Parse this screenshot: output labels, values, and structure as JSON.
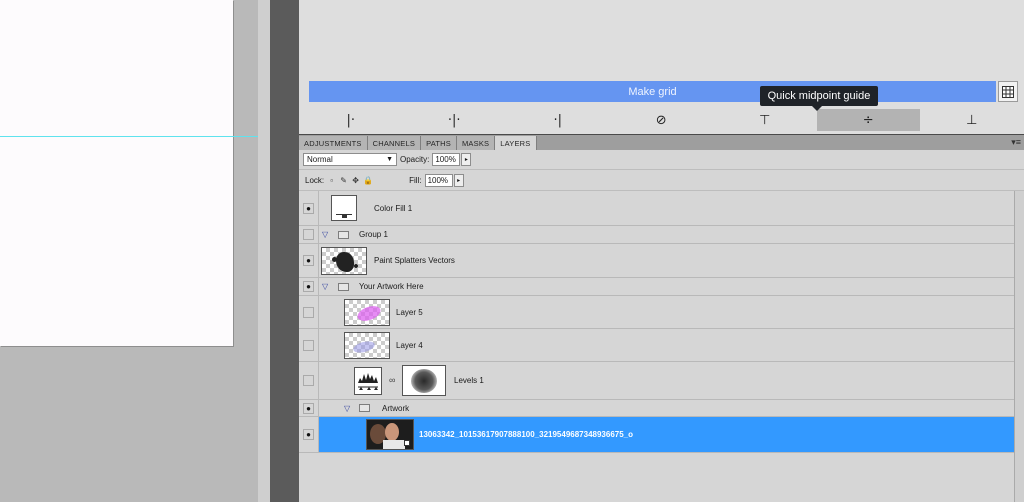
{
  "extension": {
    "make_grid_label": "Make grid",
    "grid_button_icon": "grid-icon",
    "tooltip": "Quick midpoint guide",
    "guide_buttons": [
      {
        "glyph": "|·",
        "icon": "guide-left-icon"
      },
      {
        "glyph": "·|·",
        "icon": "guide-center-vertical-icon"
      },
      {
        "glyph": "·|",
        "icon": "guide-right-icon"
      },
      {
        "glyph": "⊘",
        "icon": "clear-guides-icon"
      },
      {
        "glyph": "⊤",
        "icon": "guide-top-icon"
      },
      {
        "glyph": "÷",
        "icon": "guide-midpoint-icon"
      },
      {
        "glyph": "⊥",
        "icon": "guide-bottom-icon"
      }
    ]
  },
  "layers_panel": {
    "tabs": [
      "ADJUSTMENTS",
      "CHANNELS",
      "PATHS",
      "MASKS",
      "LAYERS"
    ],
    "active_tab": "LAYERS",
    "blend_mode": "Normal",
    "opacity_label": "Opacity:",
    "opacity_value": "100%",
    "lock_label": "Lock:",
    "fill_label": "Fill:",
    "fill_value": "100%",
    "layers": [
      {
        "name": "Color Fill 1",
        "visible": true
      },
      {
        "name": "Group 1",
        "visible": false
      },
      {
        "name": "Paint Splatters Vectors",
        "visible": true
      },
      {
        "name": "Your Artwork Here",
        "visible": true
      },
      {
        "name": "Layer 5",
        "visible": false
      },
      {
        "name": "Layer 4",
        "visible": false
      },
      {
        "name": "Levels 1",
        "visible": false
      },
      {
        "name": "Artwork",
        "visible": true
      },
      {
        "name": "13063342_10153617907888100_3219549687348936675_o",
        "visible": true,
        "selected": true
      }
    ]
  },
  "colors": {
    "make_grid_bg": "#6595f1",
    "selection": "#3399ff",
    "guide_line": "#5fe3ee",
    "tooltip_bg": "#1f2328"
  }
}
